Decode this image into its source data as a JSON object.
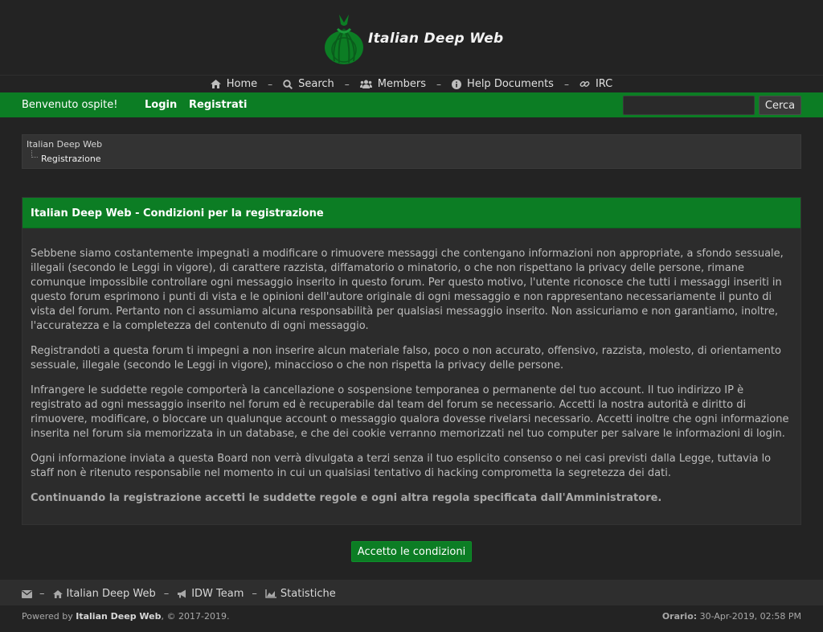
{
  "header": {
    "site_title": "Italian Deep Web"
  },
  "topnav": {
    "items": [
      {
        "label": "Home",
        "icon": "home-icon"
      },
      {
        "label": "Search",
        "icon": "search-icon"
      },
      {
        "label": "Members",
        "icon": "users-icon"
      },
      {
        "label": "Help Documents",
        "icon": "info-icon"
      },
      {
        "label": "IRC",
        "icon": "link-icon"
      }
    ],
    "separator": "–"
  },
  "userbar": {
    "welcome": "Benvenuto ospite!",
    "login": "Login",
    "register": "Registrati",
    "search_value": "",
    "search_button": "Cerca"
  },
  "breadcrumb": {
    "root": "Italian Deep Web",
    "current": "Registrazione"
  },
  "panel": {
    "title": "Italian Deep Web - Condizioni per la registrazione",
    "paragraphs": [
      "Sebbene siamo costantemente impegnati a modificare o rimuovere messaggi che contengano informazioni non appropriate, a sfondo sessuale, illegali (secondo le Leggi in vigore), di carattere razzista, diffamatorio o minatorio, o che non rispettano la privacy delle persone, rimane comunque impossibile controllare ogni messaggio inserito in questo forum. Per questo motivo, l'utente riconosce che tutti i messaggi inseriti in questo forum esprimono i punti di vista e le opinioni dell'autore originale di ogni messaggio e non rappresentano necessariamente il punto di vista del forum. Pertanto non ci assumiamo alcuna responsabilità per qualsiasi messaggio inserito. Non assicuriamo e non garantiamo, inoltre, l'accuratezza e la completezza del contenuto di ogni messaggio.",
      "Registrandoti a questa forum ti impegni a non inserire alcun materiale falso, poco o non accurato, offensivo, razzista, molesto, di orientamento sessuale, illegale (secondo le Leggi in vigore), minaccioso o che non rispetta la privacy delle persone.",
      "Infrangere le suddette regole comporterà la cancellazione o sospensione temporanea o permanente del tuo account. Il tuo indirizzo IP è registrato ad ogni messaggio inserito nel forum ed è recuperabile dal team del forum se necessario. Accetti la nostra autorità e diritto di rimuovere, modificare, o bloccare un qualunque account o messaggio qualora dovesse rivelarsi necessario. Accetti inoltre che ogni informazione inserita nel forum sia memorizzata in un database, e che dei cookie verranno memorizzati nel tuo computer per salvare le informazioni di login.",
      "Ogni informazione inviata a questa Board non verrà divulgata a terzi senza il tuo esplicito consenso o nei casi previsti dalla Legge, tuttavia lo staff non è ritenuto responsabile nel momento in cui un qualsiasi tentativo di hacking comprometta la segretezza dei dati."
    ],
    "closing": "Continuando la registrazione accetti le suddette regole e ogni altra regola specificata dall'Amministratore."
  },
  "accept_button": "Accetto le condizioni",
  "footer": {
    "links": [
      {
        "label": "",
        "icon": "envelope-icon"
      },
      {
        "label": "Italian Deep Web",
        "icon": "home-icon"
      },
      {
        "label": "IDW Team",
        "icon": "bullhorn-icon"
      },
      {
        "label": "Statistiche",
        "icon": "chart-icon"
      }
    ],
    "powered_prefix": "Powered by",
    "powered_name": "Italian Deep Web",
    "powered_suffix": ", © 2017-2019.",
    "clock_label": "Orario:",
    "clock_value": "30-Apr-2019, 02:58 PM"
  },
  "colors": {
    "accent_green": "#0c7d24",
    "background": "#232323",
    "panel": "#2c2c2c"
  }
}
